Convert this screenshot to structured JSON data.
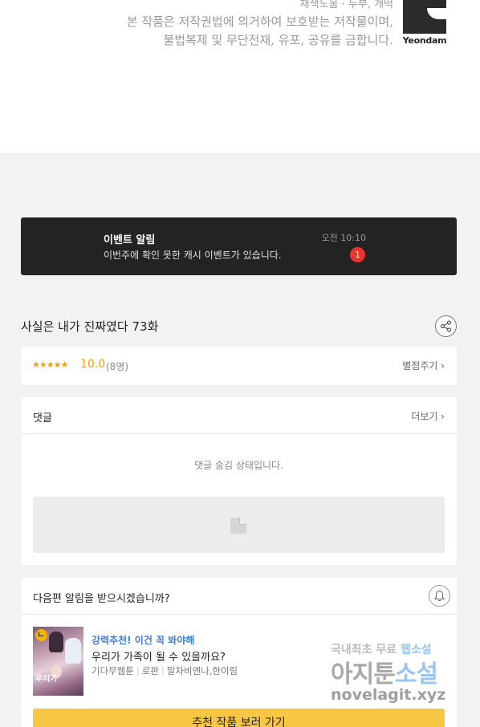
{
  "copyright": {
    "credits": "채색도움 · 두부, 개떡",
    "line1": "본 작품은 저작권법에 의거하여 보호받는 저작물이며,",
    "line2": "불법복제 및 무단전재, 유포, 공유를 금합니다.",
    "logo_text": "Yeondam"
  },
  "event": {
    "title": "이벤트 알림",
    "description": "이번주에 확인 못한 캐시 이벤트가 있습니다.",
    "time": "오전 10:10",
    "count": "1"
  },
  "episode": {
    "title": "사실은 내가 진짜였다 73화",
    "share_icon": "share-icon"
  },
  "rating": {
    "stars": "★★★★★",
    "score": "10.0",
    "participants": "(8명)",
    "rate_link": "별점주기",
    "star_color": "#f5a10a"
  },
  "comments": {
    "label": "댓글",
    "more": "더보기",
    "hidden_notice": "댓글 숨김 상태입니다."
  },
  "next": {
    "prompt": "다음편 알림을 받으시겠습니까?",
    "bell_icon": "bell-icon",
    "recommend": {
      "tag": "강력추천! 이건 꼭 봐야해",
      "title": "우리가 가족이 될 수 있을까요?",
      "cover_text": "우리가",
      "genre1": "기다무웹툰",
      "genre2": "로판",
      "authors": "말차비엔나,한이림"
    },
    "cta": "추천 작품 보러 가기",
    "cta_color": "#f7c744"
  },
  "watermark": {
    "line1_a": "국내최초 무료 ",
    "line1_b": "웹소설",
    "line2_a": "아지툰",
    "line2_b": "소설",
    "line3": "novelagit.xyz"
  },
  "chevron": "›"
}
